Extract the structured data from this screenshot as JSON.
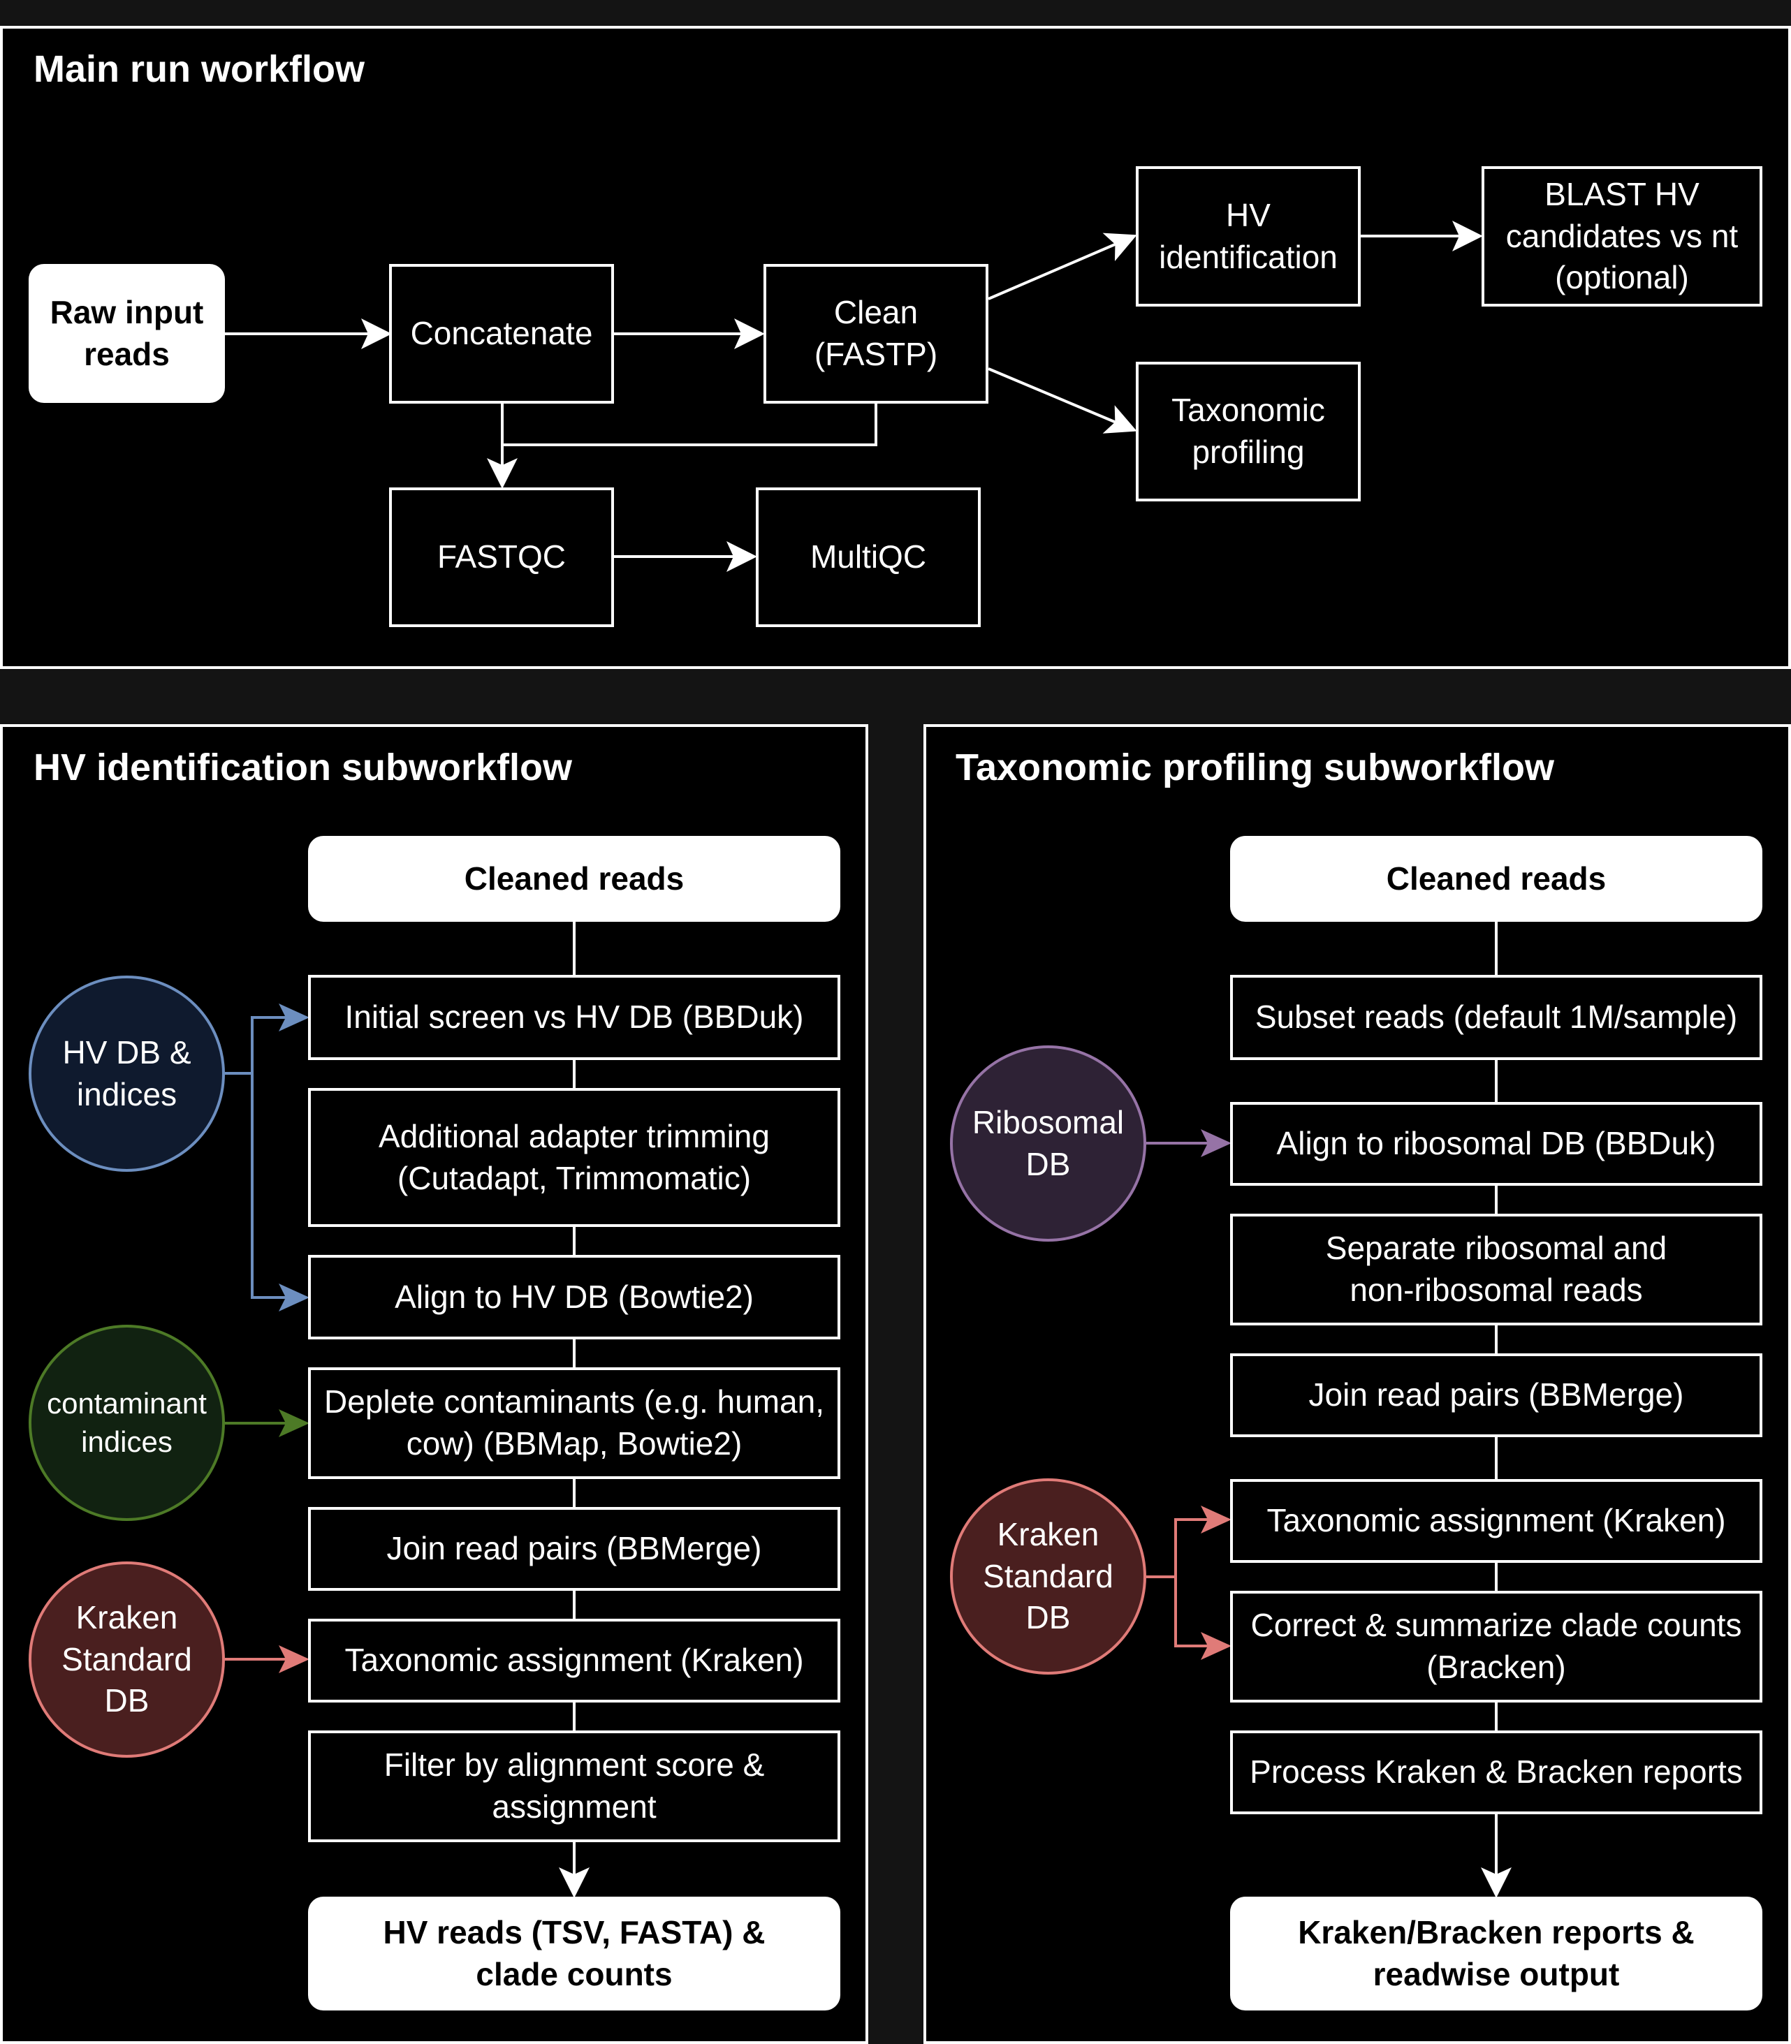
{
  "main": {
    "title": "Main run workflow",
    "nodes": {
      "raw": "Raw input\nreads",
      "concat": "Concatenate",
      "clean": "Clean\n(FASTP)",
      "hv": "HV\nidentification",
      "blast": "BLAST HV\ncandidates vs nt\n(optional)",
      "tax": "Taxonomic\nprofiling",
      "fastqc": "FASTQC",
      "multiqc": "MultiQC"
    }
  },
  "hv_sub": {
    "title": "HV identification subworkflow",
    "start": "Cleaned reads",
    "steps": [
      "Initial screen vs HV DB (BBDuk)",
      "Additional adapter trimming\n(Cutadapt, Trimmomatic)",
      "Align to HV DB (Bowtie2)",
      "Deplete contaminants (e.g. human,\ncow) (BBMap, Bowtie2)",
      "Join read pairs (BBMerge)",
      "Taxonomic assignment (Kraken)",
      "Filter by alignment score &\nassignment"
    ],
    "end": "HV reads (TSV, FASTA) &\nclade counts",
    "resources": [
      {
        "label": "HV DB &\nindices",
        "stroke": "#6c8ebf",
        "fill": "#0f1a2e"
      },
      {
        "label": "contaminant\nindices",
        "stroke": "#4d7a26",
        "fill": "#112211"
      },
      {
        "label": "Kraken\nStandard\nDB",
        "stroke": "#e07b78",
        "fill": "#4a1f1f"
      }
    ]
  },
  "tax_sub": {
    "title": "Taxonomic profiling subworkflow",
    "start": "Cleaned reads",
    "steps": [
      "Subset reads (default 1M/sample)",
      "Align to ribosomal DB (BBDuk)",
      "Separate ribosomal and\nnon-ribosomal reads",
      "Join read pairs (BBMerge)",
      "Taxonomic assignment (Kraken)",
      "Correct & summarize clade counts\n(Bracken)",
      "Process Kraken & Bracken reports"
    ],
    "end": "Kraken/Bracken reports &\nreadwise output",
    "resources": [
      {
        "label": "Ribosomal\nDB",
        "stroke": "#9673a6",
        "fill": "#2e2235"
      },
      {
        "label": "Kraken\nStandard\nDB",
        "stroke": "#e07b78",
        "fill": "#4a1f1f"
      }
    ]
  }
}
